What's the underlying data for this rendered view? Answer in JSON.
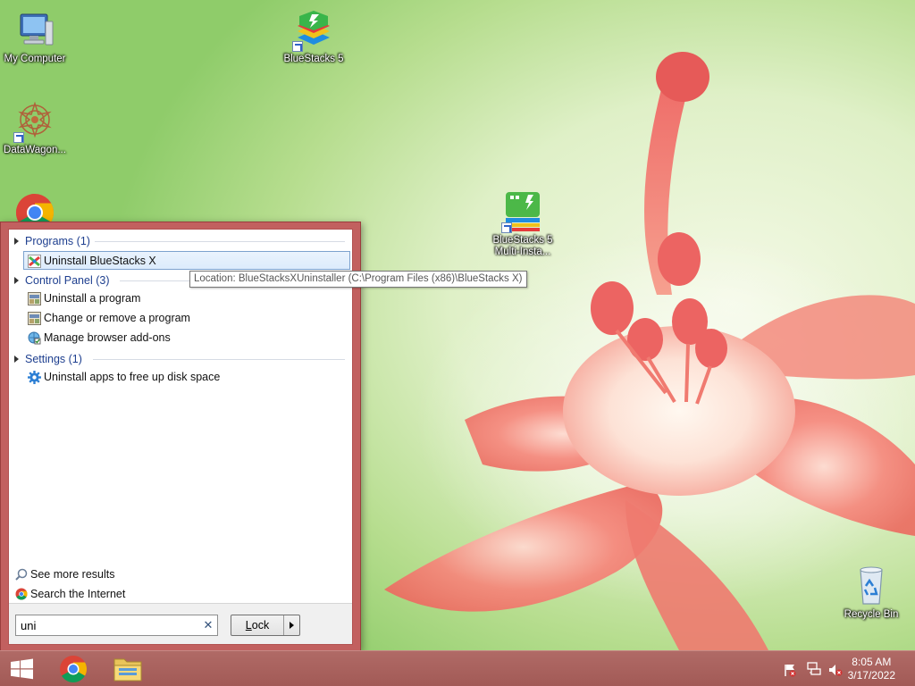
{
  "desktop": {
    "icons": [
      {
        "label": "My Computer",
        "icon": "computer-icon"
      },
      {
        "label": "BlueStacks 5",
        "icon": "bluestacks-icon"
      },
      {
        "label": "DataWagon...",
        "icon": "datawagon-icon"
      },
      {
        "label": "BlueStacks 5 Multi-Insta...",
        "line1": "BlueStacks 5",
        "line2": "Multi-Insta...",
        "icon": "bluestacks-multi-instance-icon"
      },
      {
        "label": "Recycle Bin",
        "icon": "recycle-bin-icon"
      }
    ]
  },
  "search_panel": {
    "groups": [
      {
        "title": "Programs (1)",
        "items": [
          "Uninstall BlueStacks X"
        ]
      },
      {
        "title": "Control Panel (3)",
        "items": [
          "Uninstall a program",
          "Change or remove a program",
          "Manage browser add-ons"
        ]
      },
      {
        "title": "Settings (1)",
        "items": [
          "Uninstall apps to free up disk space"
        ]
      }
    ],
    "selected_item": "Uninstall BlueStacks X",
    "tooltip": "Location: BlueStacksXUninstaller (C:\\Program Files (x86)\\BlueStacks X)",
    "see_more": "See more results",
    "search_internet": "Search the Internet",
    "search_value": "uni",
    "clear_glyph": "✕",
    "lock_button": {
      "label_underlined": "L",
      "label_rest": "ock"
    }
  },
  "taskbar": {
    "time": "8:05 AM",
    "date": "3/17/2022",
    "pinned": [
      "start-button",
      "chrome-taskbar-icon",
      "file-explorer-icon"
    ]
  },
  "colors": {
    "start_panel": "#c2605f",
    "taskbar": "#a25a56",
    "group_heading": "#1e3f8f"
  }
}
